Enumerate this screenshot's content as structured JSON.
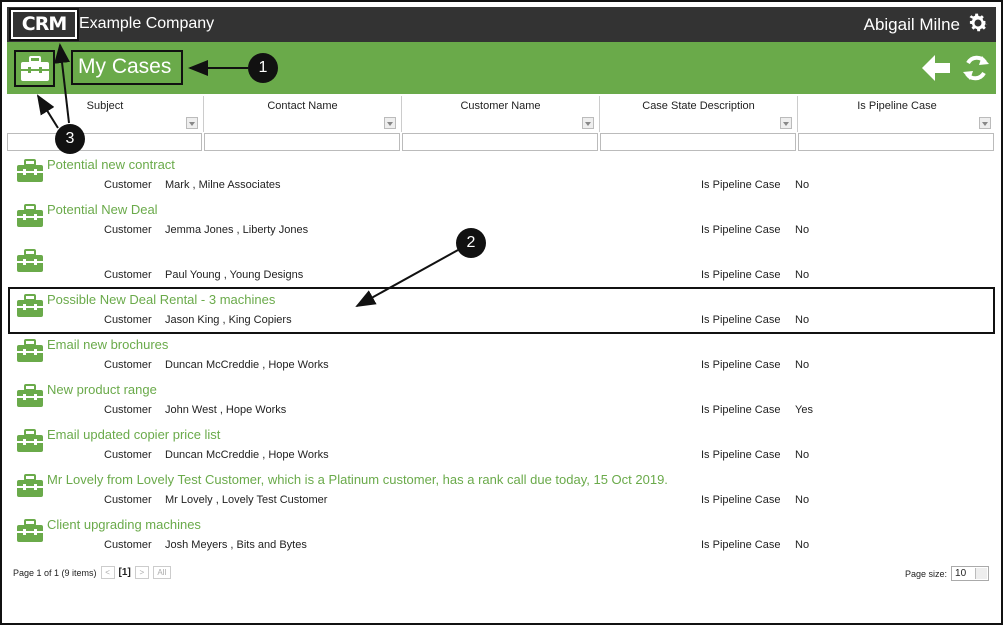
{
  "app": {
    "logo_text": "CRM",
    "company": "Example Company",
    "user_name": "Abigail Milne",
    "gear_icon": "gear-icon"
  },
  "header": {
    "title": "My Cases",
    "case_icon": "briefcase-icon",
    "back_icon": "back-arrow-icon",
    "refresh_icon": "refresh-icon"
  },
  "grid": {
    "columns": [
      "Subject",
      "Contact Name",
      "Customer Name",
      "Case State Description",
      "Is Pipeline Case"
    ],
    "label_customer": "Customer",
    "label_pipeline": "Is Pipeline Case",
    "rows": [
      {
        "subject": "Potential new contract",
        "customer": "Mark , Milne Associates",
        "pipeline": "No"
      },
      {
        "subject": "Potential New Deal",
        "customer": "Jemma Jones , Liberty Jones",
        "pipeline": "No"
      },
      {
        "subject": "",
        "customer": "Paul Young , Young Designs",
        "pipeline": "No"
      },
      {
        "subject": "Possible New Deal Rental - 3 machines",
        "customer": "Jason King , King Copiers",
        "pipeline": "No"
      },
      {
        "subject": "Email new brochures",
        "customer": "Duncan McCreddie , Hope Works",
        "pipeline": "No"
      },
      {
        "subject": "New product range",
        "customer": "John West , Hope Works",
        "pipeline": "Yes"
      },
      {
        "subject": "Email updated copier price list",
        "customer": "Duncan McCreddie , Hope Works",
        "pipeline": "No"
      },
      {
        "subject": "Mr Lovely from Lovely Test Customer, which is a Platinum customer, has a rank call due today, 15 Oct 2019.",
        "customer": "Mr Lovely , Lovely Test Customer",
        "pipeline": "No"
      },
      {
        "subject": "Client upgrading machines",
        "customer": "Josh Meyers , Bits and Bytes",
        "pipeline": "No"
      }
    ]
  },
  "pager": {
    "info": "Page 1 of 1 (9 items)",
    "prev": "<",
    "current": "[1]",
    "next": ">",
    "all": "All",
    "size_label": "Page size:",
    "size_value": "10"
  },
  "callouts": {
    "one": "1",
    "two": "2",
    "three": "3"
  },
  "colors": {
    "accent": "#6aaa4a",
    "topbar": "#333333"
  }
}
